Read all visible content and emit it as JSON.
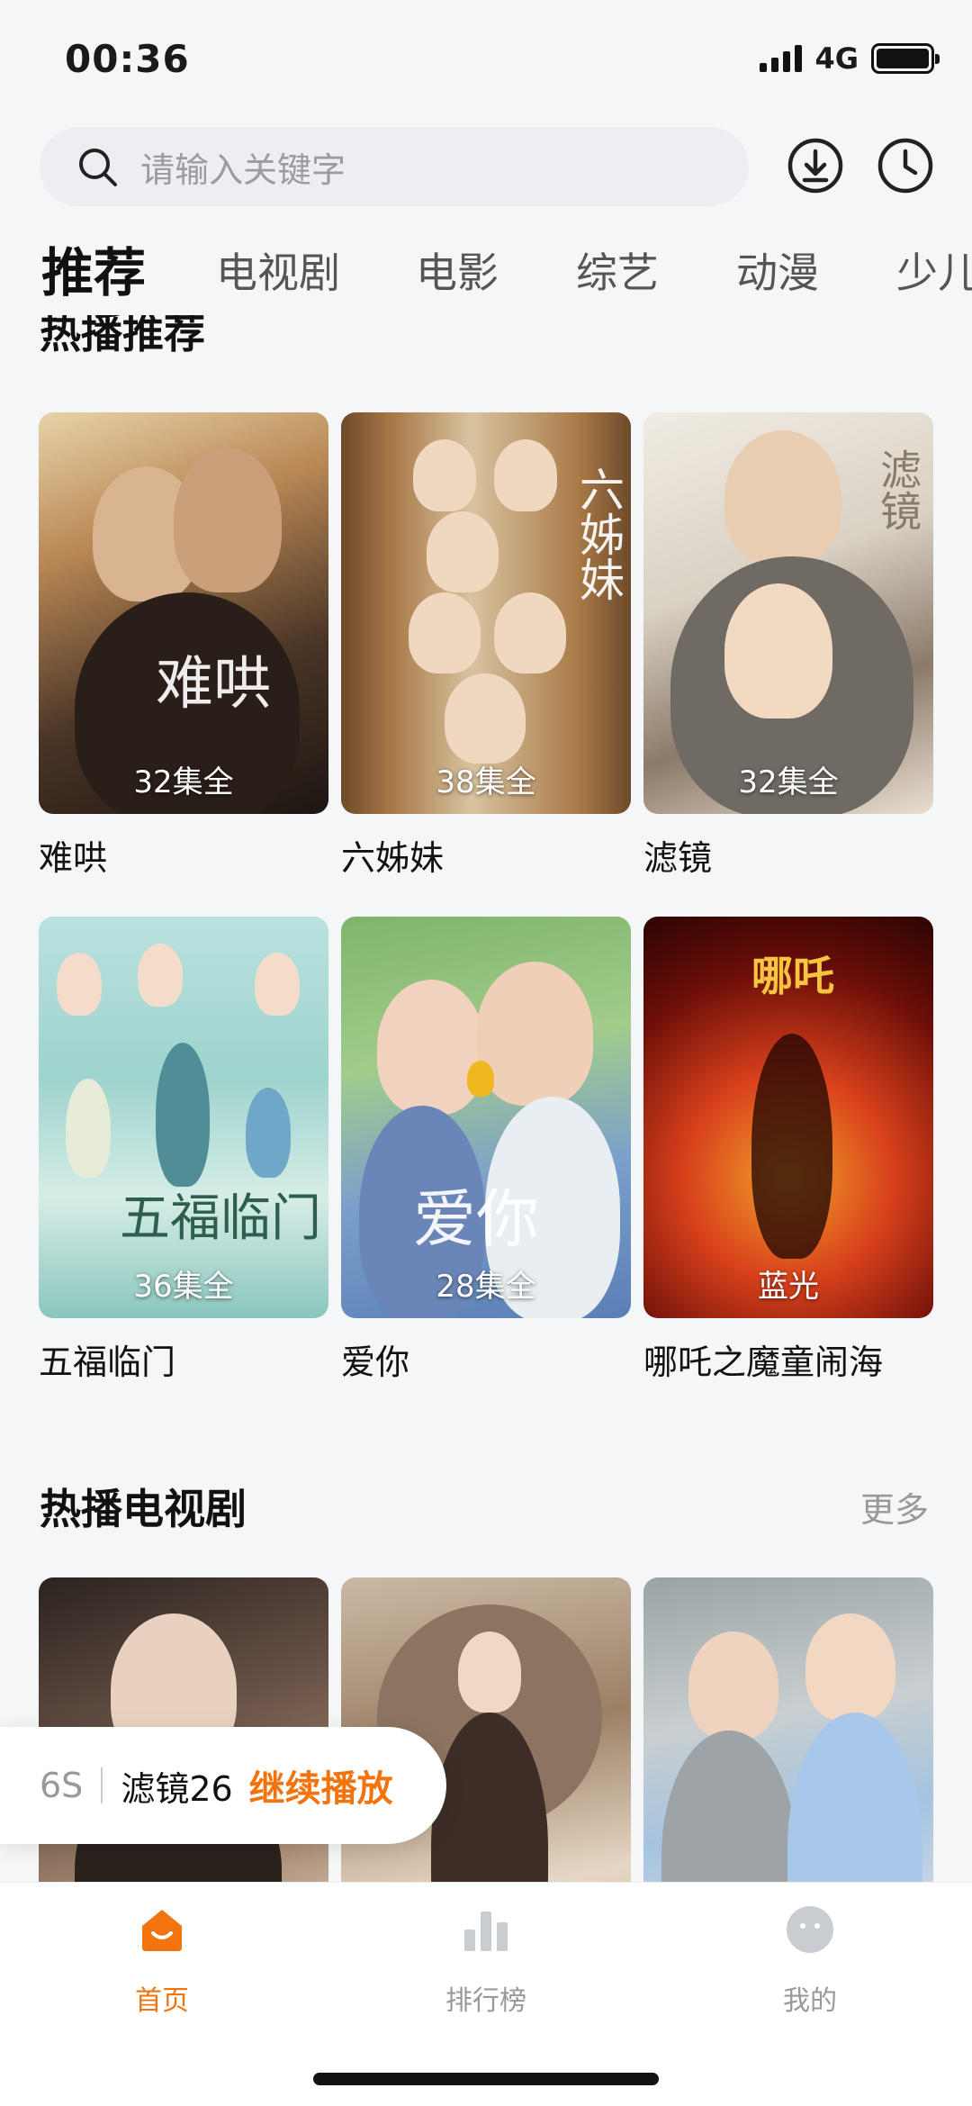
{
  "status_bar": {
    "time": "00:36",
    "network": "4G"
  },
  "search": {
    "placeholder": "请输入关键字"
  },
  "top_icons": {
    "download": "download-icon",
    "history": "clock-icon"
  },
  "tabs": [
    {
      "label": "推荐",
      "active": true
    },
    {
      "label": "电视剧",
      "active": false
    },
    {
      "label": "电影",
      "active": false
    },
    {
      "label": "综艺",
      "active": false
    },
    {
      "label": "动漫",
      "active": false
    },
    {
      "label": "少儿",
      "active": false
    }
  ],
  "hot_recommend": {
    "title": "热播推荐",
    "items": [
      {
        "title": "难哄",
        "badge": "32集全",
        "poster_text": "难哄"
      },
      {
        "title": "六姊妹",
        "badge": "38集全",
        "poster_text": "六姊妹"
      },
      {
        "title": "滤镜",
        "badge": "32集全",
        "poster_text": "滤镜"
      },
      {
        "title": "五福临门",
        "badge": "36集全",
        "poster_text": "五福临门"
      },
      {
        "title": "爱你",
        "badge": "28集全",
        "poster_text": "爱你"
      },
      {
        "title": "哪吒之魔童闹海",
        "badge": "蓝光",
        "poster_text": "哪吒"
      }
    ]
  },
  "hot_tv": {
    "title": "热播电视剧",
    "more": "更多"
  },
  "resume": {
    "time": "6S",
    "title": "滤镜26",
    "action": "继续播放"
  },
  "bottom_nav": [
    {
      "label": "首页",
      "icon": "home-icon",
      "active": true
    },
    {
      "label": "排行榜",
      "icon": "bar-chart-icon",
      "active": false
    },
    {
      "label": "我的",
      "icon": "profile-icon",
      "active": false
    }
  ],
  "colors": {
    "accent": "#f2740f",
    "background": "#f5f6f8"
  }
}
